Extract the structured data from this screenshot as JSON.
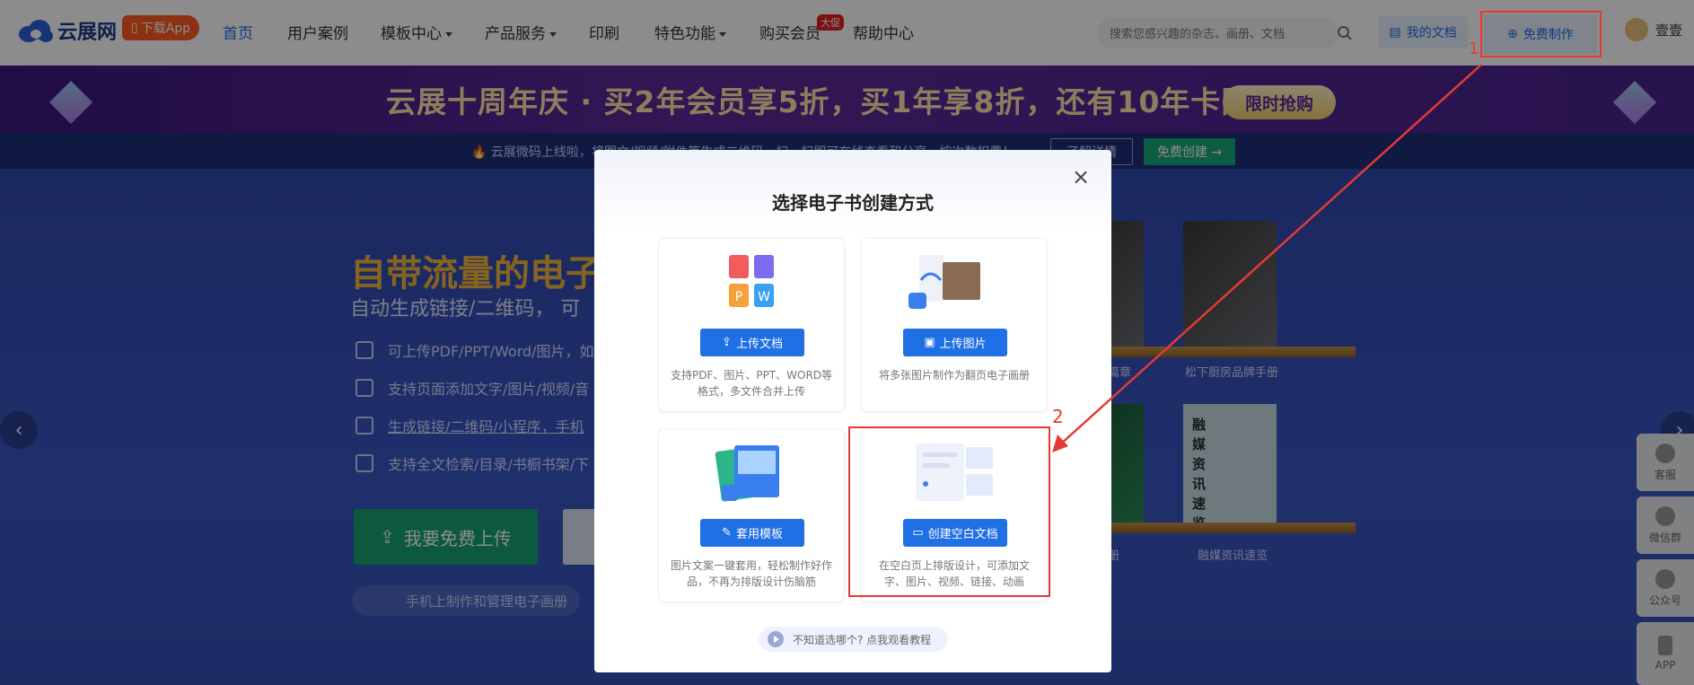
{
  "nav": {
    "logo_text": "云展网",
    "app_badge": "下载App",
    "items": [
      "首页",
      "用户案例",
      "模板中心",
      "产品服务",
      "印刷",
      "特色功能",
      "购买会员",
      "帮助中心"
    ],
    "hot_badge": "大促",
    "search_placeholder": "搜索您感兴趣的杂志、画册、文档",
    "my_docs": "我的文档",
    "free_make": "免费制作",
    "user_name": "壹壹"
  },
  "promo": {
    "text": "云展十周年庆 · 买2年会员享5折，买1年享8折，还有10年卡限时抢!",
    "button": "限时抢购"
  },
  "notice": {
    "text": "🔥 云展微码上线啦，将图文/视频/附件等生成二维码，扫一扫即可在线查看和分享，按次数扣费！",
    "btn_more": "了解详情",
    "btn_create": "免费创建 →"
  },
  "hero": {
    "title": "自带流量的电子",
    "subtitle": "自动生成链接/二维码， 可",
    "features": [
      "可上传PDF/PPT/Word/图片，如",
      "支持页面添加文字/图片/视频/音",
      "生成链接/二维码/小程序，手机",
      "支持全文检索/目录/书橱书架/下"
    ],
    "upload_button": "我要免费上传",
    "mobile_text": "手机上制作和管理电子画册",
    "shelf_labels": [
      "篇章",
      "松下厨房品牌手册",
      "册",
      "融媒资讯速览"
    ],
    "book_text": "融媒资讯速览"
  },
  "float_bar": [
    "客服",
    "微信群",
    "公众号",
    "APP"
  ],
  "modal": {
    "title": "选择电子书创建方式",
    "cards": [
      {
        "button": "上传文档",
        "desc": "支持PDF、图片、PPT、WORD等格式，多文件合并上传"
      },
      {
        "button": "上传图片",
        "desc": "将多张图片制作为翻页电子画册"
      },
      {
        "button": "套用模板",
        "desc": "图片文案一键套用，轻松制作好作品，不再为排版设计伤脑筋"
      },
      {
        "button": "创建空白文档",
        "desc": "在空白页上排版设计，可添加文字、图片、视频、链接、动画"
      }
    ],
    "tutorial": "不知道选哪个? 点我观看教程"
  },
  "annotations": {
    "step1": "1",
    "step2": "2",
    "color": "#e53935"
  },
  "colors": {
    "primary": "#1f6fe5",
    "green": "#17a26f",
    "gold": "#f2b63a"
  }
}
